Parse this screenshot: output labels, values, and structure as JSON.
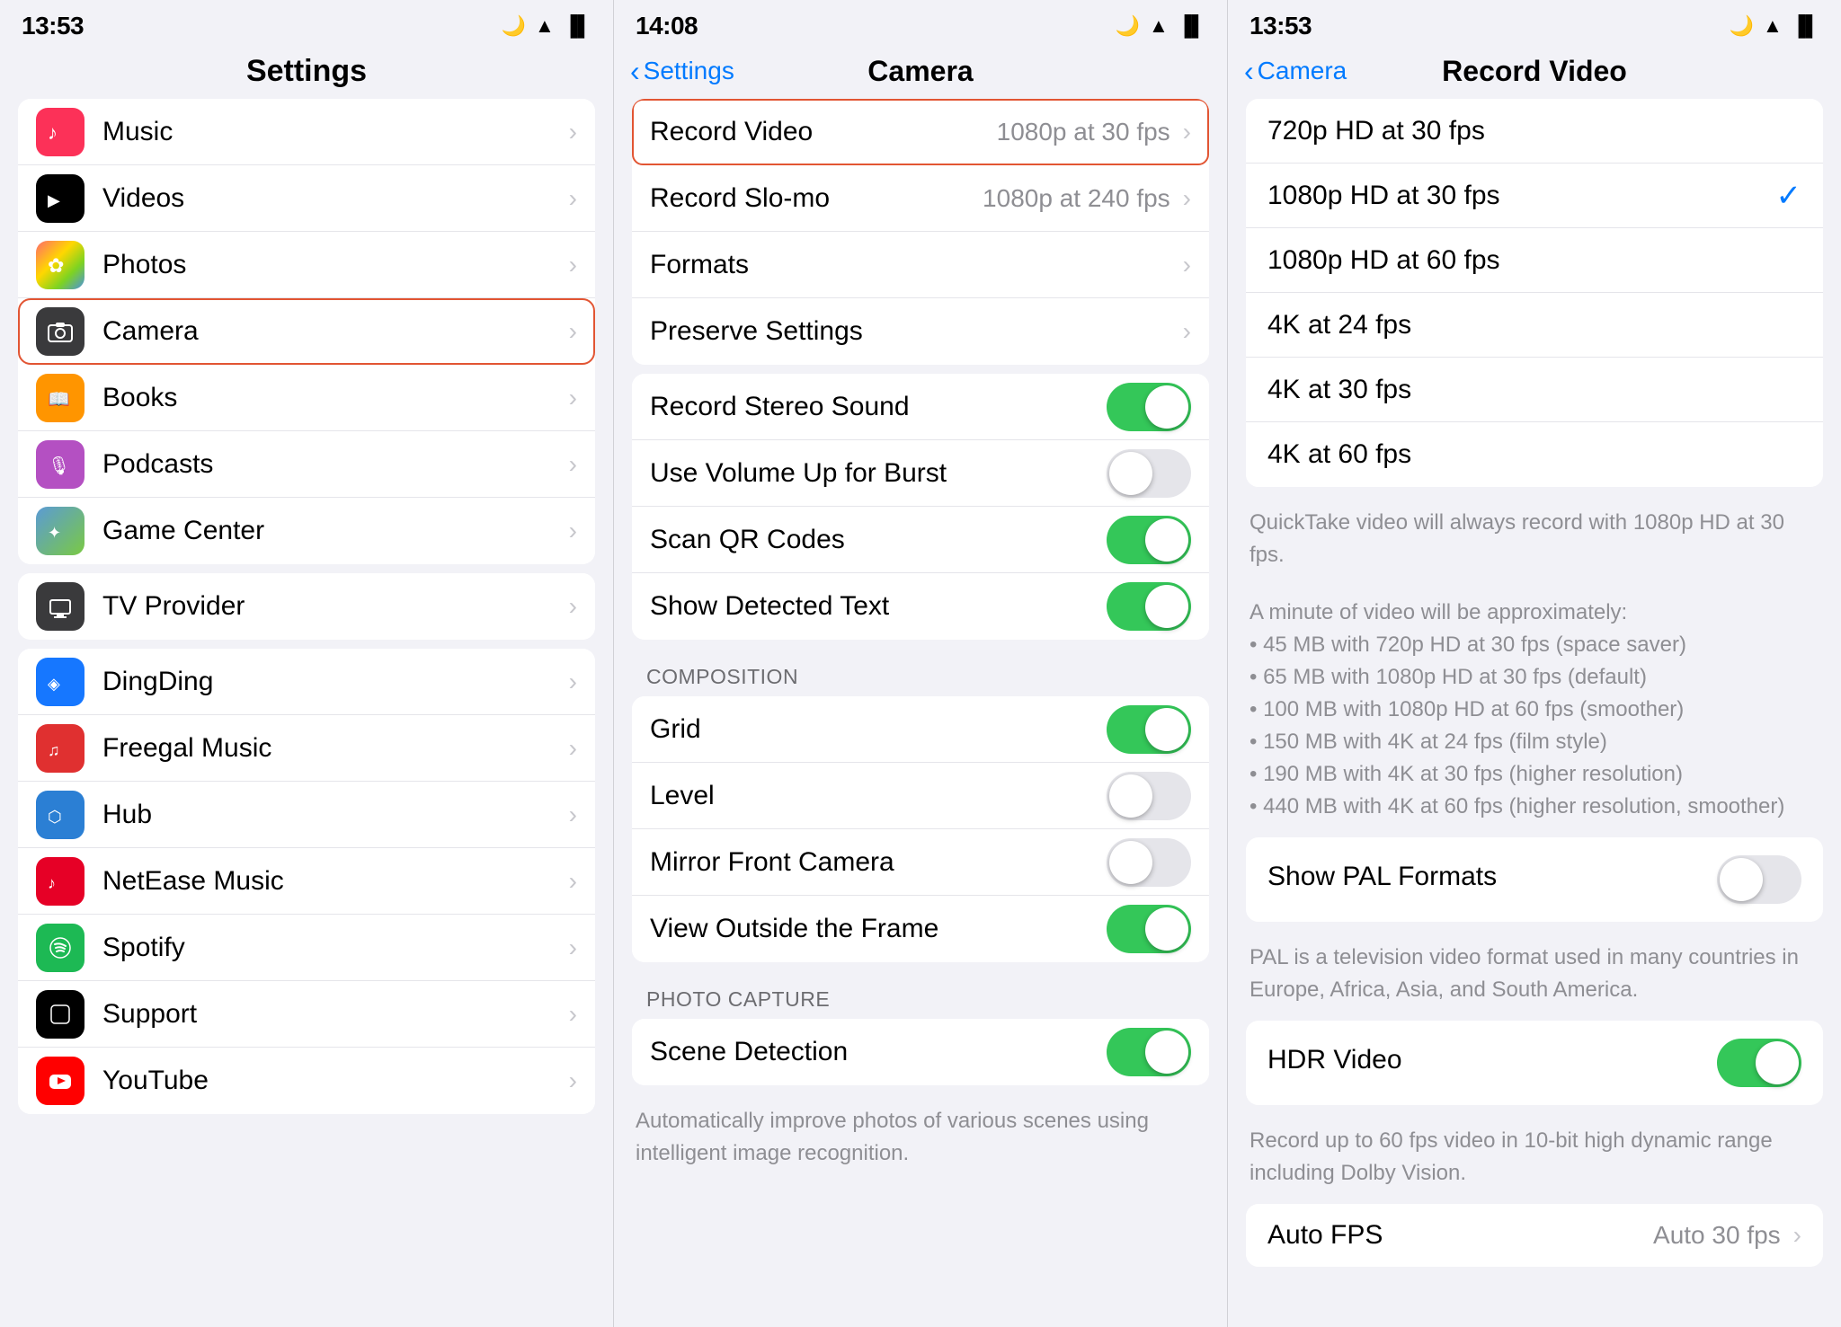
{
  "panel1": {
    "statusBar": {
      "time": "13:53",
      "moonIcon": "🌙"
    },
    "title": "Settings",
    "items": [
      {
        "id": "music",
        "label": "Music",
        "iconBg": "icon-music",
        "iconChar": "♪",
        "selected": false
      },
      {
        "id": "videos",
        "label": "Videos",
        "iconBg": "icon-videos",
        "iconChar": "▶",
        "selected": false
      },
      {
        "id": "photos",
        "label": "Photos",
        "iconBg": "icon-photos",
        "iconChar": "✿",
        "selected": false
      },
      {
        "id": "camera",
        "label": "Camera",
        "iconBg": "icon-camera",
        "iconChar": "📷",
        "selected": true
      },
      {
        "id": "books",
        "label": "Books",
        "iconBg": "icon-books",
        "iconChar": "📖",
        "selected": false
      },
      {
        "id": "podcasts",
        "label": "Podcasts",
        "iconBg": "icon-podcasts",
        "iconChar": "🎙",
        "selected": false
      },
      {
        "id": "gamecenter",
        "label": "Game Center",
        "iconBg": "icon-gamecenter",
        "iconChar": "✦",
        "selected": false
      }
    ],
    "providerItem": {
      "label": "TV Provider",
      "iconBg": "icon-tvprovider",
      "iconChar": "📺"
    },
    "appItems": [
      {
        "id": "dingding",
        "label": "DingDing",
        "iconBg": "icon-dingding",
        "iconChar": "◈"
      },
      {
        "id": "freegal",
        "label": "Freegal Music",
        "iconBg": "icon-freegal",
        "iconChar": "♫"
      },
      {
        "id": "hub",
        "label": "Hub",
        "iconBg": "icon-hub",
        "iconChar": "⬡"
      },
      {
        "id": "netease",
        "label": "NetEase Music",
        "iconBg": "icon-netease",
        "iconChar": "♪"
      },
      {
        "id": "spotify",
        "label": "Spotify",
        "iconBg": "icon-spotify",
        "iconChar": "♫"
      },
      {
        "id": "support",
        "label": "Support",
        "iconBg": "icon-support",
        "iconChar": ""
      },
      {
        "id": "youtube",
        "label": "YouTube",
        "iconBg": "icon-youtube",
        "iconChar": "▶"
      }
    ]
  },
  "panel2": {
    "statusBar": {
      "time": "14:08",
      "moonIcon": "🌙"
    },
    "backLabel": "Settings",
    "title": "Camera",
    "items": [
      {
        "id": "recordvideo",
        "label": "Record Video",
        "value": "1080p at 30 fps",
        "type": "nav",
        "highlighted": true
      },
      {
        "id": "recordslomo",
        "label": "Record Slo-mo",
        "value": "1080p at 240 fps",
        "type": "nav"
      },
      {
        "id": "formats",
        "label": "Formats",
        "value": "",
        "type": "nav"
      },
      {
        "id": "preservesettings",
        "label": "Preserve Settings",
        "value": "",
        "type": "nav"
      }
    ],
    "toggleItems": [
      {
        "id": "recordstereo",
        "label": "Record Stereo Sound",
        "on": true
      },
      {
        "id": "volumeburst",
        "label": "Use Volume Up for Burst",
        "on": false
      },
      {
        "id": "scanqr",
        "label": "Scan QR Codes",
        "on": true
      },
      {
        "id": "showdetectedtext",
        "label": "Show Detected Text",
        "on": true
      }
    ],
    "compositionLabel": "COMPOSITION",
    "compositionItems": [
      {
        "id": "grid",
        "label": "Grid",
        "on": true
      },
      {
        "id": "level",
        "label": "Level",
        "on": false
      },
      {
        "id": "mirrorfrontcamera",
        "label": "Mirror Front Camera",
        "on": false
      },
      {
        "id": "viewoutsideframe",
        "label": "View Outside the Frame",
        "on": true
      }
    ],
    "photoCaptureLabel": "PHOTO CAPTURE",
    "photoCaptureItems": [
      {
        "id": "scenedetection",
        "label": "Scene Detection",
        "on": true
      }
    ],
    "sceneDetectionDesc": "Automatically improve photos of various scenes using intelligent image recognition."
  },
  "panel3": {
    "statusBar": {
      "time": "13:53",
      "moonIcon": "🌙"
    },
    "backLabel": "Camera",
    "title": "Record Video",
    "options": [
      {
        "id": "720p30",
        "label": "720p HD at 30 fps",
        "selected": false
      },
      {
        "id": "1080p30",
        "label": "1080p HD at 30 fps",
        "selected": true
      },
      {
        "id": "1080p60",
        "label": "1080p HD at 60 fps",
        "selected": false
      },
      {
        "id": "4k24",
        "label": "4K at 24 fps",
        "selected": false
      },
      {
        "id": "4k30",
        "label": "4K at 30 fps",
        "selected": false
      },
      {
        "id": "4k60",
        "label": "4K at 60 fps",
        "selected": false
      }
    ],
    "quicktakeNote": "QuickTake video will always record with 1080p HD at 30 fps.",
    "minuteNote": "A minute of video will be approximately:\n• 45 MB with 720p HD at 30 fps (space saver)\n• 65 MB with 1080p HD at 30 fps (default)\n• 100 MB with 1080p HD at 60 fps (smoother)\n• 150 MB with 4K at 24 fps (film style)\n• 190 MB with 4K at 30 fps (higher resolution)\n• 440 MB with 4K at 60 fps (higher resolution, smoother)",
    "palSection": {
      "title": "Show PAL Formats",
      "desc": "PAL is a television video format used in many countries in Europe, Africa, Asia, and South America.",
      "on": false
    },
    "hdrSection": {
      "title": "HDR Video",
      "desc": "Record up to 60 fps video in 10-bit high dynamic range including Dolby Vision.",
      "on": true
    },
    "autoFPS": {
      "label": "Auto FPS",
      "value": "Auto 30 fps"
    }
  }
}
